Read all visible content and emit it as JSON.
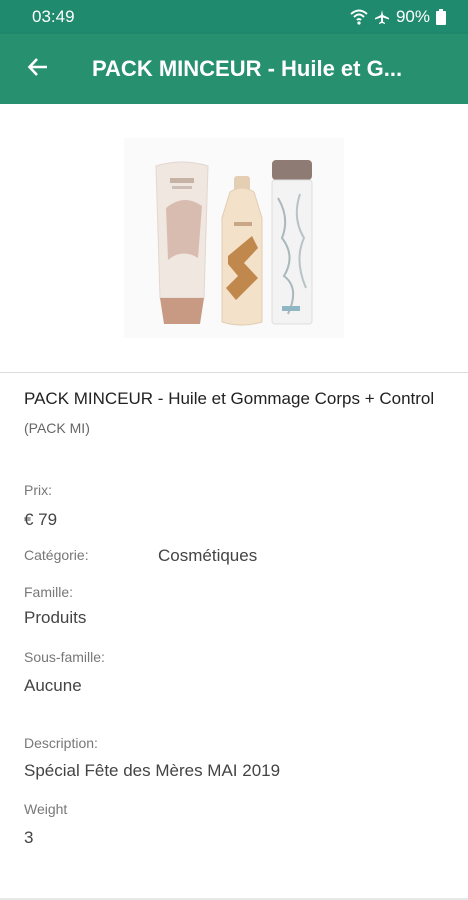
{
  "status_bar": {
    "time": "03:49",
    "battery": "90%"
  },
  "app_bar": {
    "title": "PACK MINCEUR - Huile et G..."
  },
  "product": {
    "title": "PACK MINCEUR - Huile et Gommage Corps + Control",
    "code": "(PACK MI)",
    "price_label": "Prix:",
    "price": "€ 79",
    "category_label": "Catégorie:",
    "category": "Cosmétiques",
    "family_label": "Famille:",
    "family": "Produits",
    "subfamily_label": "Sous-famille:",
    "subfamily": "Aucune",
    "description_label": "Description:",
    "description": "Spécial Fête des Mères MAI 2019",
    "weight_label": "Weight",
    "weight": "3"
  },
  "colors": {
    "status_bar": "#1f8a6e",
    "app_bar": "#27906f"
  }
}
